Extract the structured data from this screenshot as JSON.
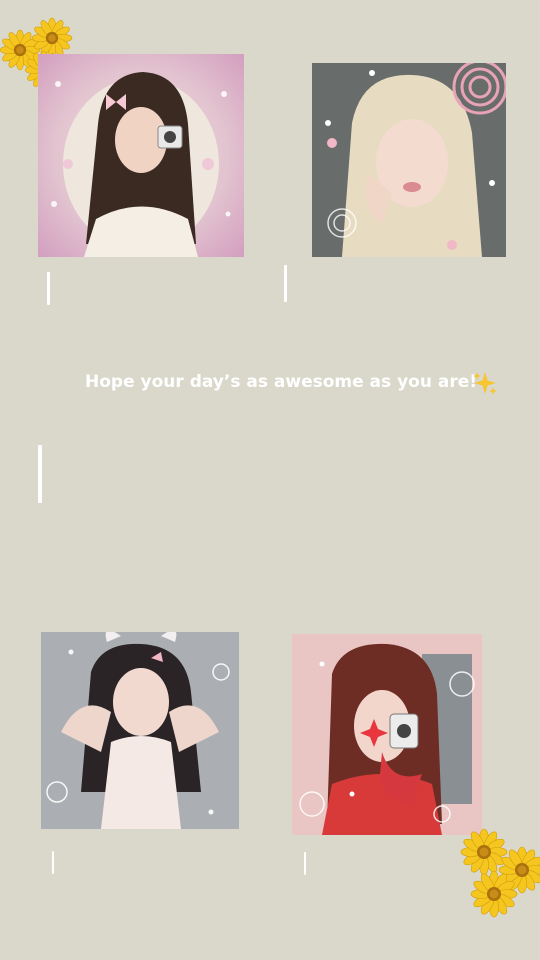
{
  "message": {
    "text": "Hope your day’s as awesome as you are!"
  },
  "icons": {
    "sparkle": "sparkles-emoji-icon",
    "flowers": "yellow-daisy-sticker-icon"
  },
  "colors": {
    "background": "#d9d8cb",
    "message_text": "#ffffff",
    "flower_petal": "#f5c61f",
    "flower_center": "#a9720c"
  }
}
